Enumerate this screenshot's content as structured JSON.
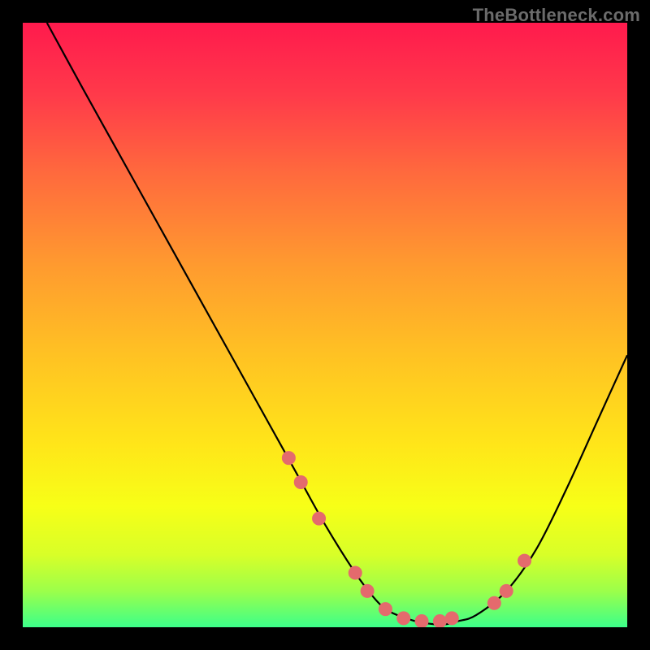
{
  "watermark": "TheBottleneck.com",
  "colors": {
    "background": "#000000",
    "gradient_top": "#ff1a4d",
    "gradient_bottom": "#3cff8a",
    "curve": "#000000",
    "marker": "#e46a6d"
  },
  "chart_data": {
    "type": "line",
    "title": "",
    "xlabel": "",
    "ylabel": "",
    "xlim": [
      0,
      100
    ],
    "ylim": [
      0,
      100
    ],
    "grid": false,
    "legend": false,
    "series": [
      {
        "name": "curve",
        "x": [
          4,
          10,
          15,
          20,
          25,
          30,
          35,
          40,
          45,
          50,
          55,
          58,
          60,
          62,
          65,
          68,
          70,
          72,
          75,
          80,
          85,
          90,
          95,
          100
        ],
        "y": [
          100,
          89,
          80,
          71,
          62,
          53,
          44,
          35,
          26,
          17,
          9,
          5,
          3,
          2,
          1,
          0.5,
          0.5,
          1,
          2,
          6,
          13,
          23,
          34,
          45
        ]
      }
    ],
    "markers": {
      "x": [
        44,
        46,
        49,
        55,
        57,
        60,
        63,
        66,
        69,
        71,
        78,
        80,
        83
      ],
      "y": [
        28,
        24,
        18,
        9,
        6,
        3,
        1.5,
        1,
        1,
        1.5,
        4,
        6,
        11
      ]
    }
  }
}
